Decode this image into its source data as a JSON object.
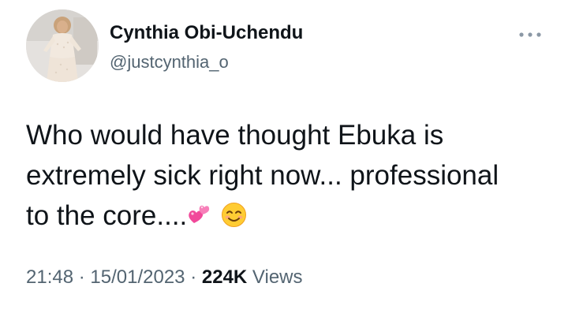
{
  "author": {
    "display_name": "Cynthia Obi-Uchendu",
    "handle": "@justcynthia_o",
    "avatar_icon": "profile-photo-avatar"
  },
  "more_icon": "more-options-icon",
  "tweet": {
    "lines": [
      "Who would have thought Ebuka is",
      "extremely sick right now... professional",
      "to the core...."
    ],
    "emojis": [
      "two-hearts-emoji",
      "smiling-face-emoji"
    ]
  },
  "meta": {
    "time": "21:48",
    "separator": "·",
    "date": "15/01/2023",
    "views_count": "224K",
    "views_label": "Views"
  },
  "colors": {
    "primary_text": "#0f1419",
    "secondary_text": "#536471",
    "background": "#ffffff"
  }
}
